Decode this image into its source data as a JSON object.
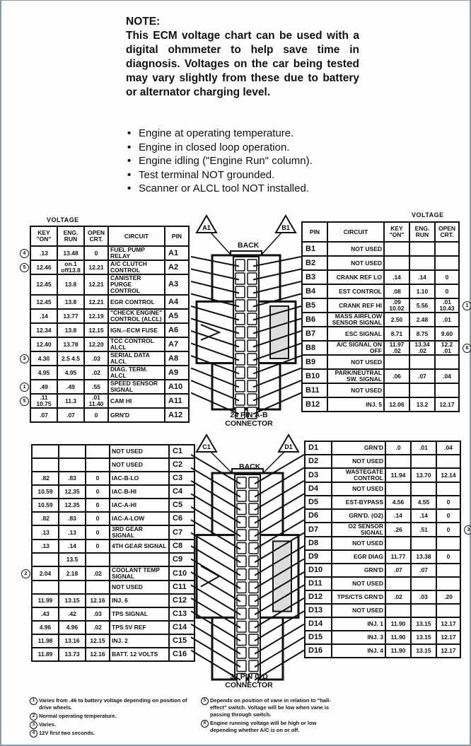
{
  "note": {
    "title": "NOTE:",
    "body": "This ECM voltage chart can be used with a digital ohmmeter to help save time in diagnosis. Voltages on the car being tested may vary slightly from these due to battery or alternator charging level."
  },
  "conditions": [
    "Engine at operating temperature.",
    "Engine in closed loop operation.",
    "Engine idling (\"Engine Run\" column).",
    "Test terminal NOT grounded.",
    "Scanner or ALCL tool NOT installed."
  ],
  "headers": {
    "voltage": "VOLTAGE",
    "key_on": "KEY \"ON\"",
    "eng_run": "ENG. RUN",
    "open_crt": "OPEN CRT.",
    "circuit": "CIRCUIT",
    "pin": "PIN"
  },
  "table_a": [
    {
      "note": "4",
      "key": ".13",
      "run": "13.48",
      "open": "0",
      "circuit": "FUEL PUMP RELAY",
      "pin": "A1"
    },
    {
      "note": "5",
      "key": "12.46",
      "run": "on.1 off13.8",
      "open": "12.21",
      "circuit": "A/C CLUTCH CONTROL",
      "pin": "A2"
    },
    {
      "note": "",
      "key": "12.45",
      "run": "13.8",
      "open": "12.21",
      "circuit": "CANISTER PURGE CONTROL",
      "pin": "A3"
    },
    {
      "note": "",
      "key": "12.45",
      "run": "13.8",
      "open": "12.21",
      "circuit": "EGR CONTROL",
      "pin": "A4"
    },
    {
      "note": "",
      "key": ".14",
      "run": "13.77",
      "open": "12.19",
      "circuit": "\"CHECK ENGINE\" CONTROL (ALCL)",
      "pin": "A5"
    },
    {
      "note": "",
      "key": "12.34",
      "run": "13.8",
      "open": "12.15",
      "circuit": "IGN.--ECM FUSE",
      "pin": "A6"
    },
    {
      "note": "",
      "key": "12.40",
      "run": "13.78",
      "open": "12.20",
      "circuit": "TCC CONTROL ALCL",
      "pin": "A7"
    },
    {
      "note": "3",
      "key": "4.30",
      "run": "2.5 4.5",
      "open": ".03",
      "circuit": "SERIAL DATA ALCL",
      "pin": "A8"
    },
    {
      "note": "",
      "key": "4.95",
      "run": "4.95",
      "open": ".02",
      "circuit": "DIAG. TERM. ALCL",
      "pin": "A9"
    },
    {
      "note": "1",
      "key": ".49",
      "run": ".49",
      "open": ".55",
      "circuit": "SPEED SENSOR SIGNAL",
      "pin": "A10"
    },
    {
      "note": "5",
      "key": ".11 10.75",
      "run": "11.3",
      "open": ".01 11.40",
      "circuit": "CAM HI",
      "pin": "A11"
    },
    {
      "note": "",
      "key": ".07",
      "run": ".07",
      "open": "0",
      "circuit": "GRN'D",
      "pin": "A12"
    }
  ],
  "table_b": [
    {
      "pin": "B1",
      "circuit": "NOT USED",
      "key": "",
      "run": "",
      "open": "",
      "note": ""
    },
    {
      "pin": "B2",
      "circuit": "NOT USED",
      "key": "",
      "run": "",
      "open": "",
      "note": ""
    },
    {
      "pin": "B3",
      "circuit": "CRANK REF LO",
      "key": ".14",
      "run": ".14",
      "open": "0",
      "note": ""
    },
    {
      "pin": "B4",
      "circuit": "EST CONTROL",
      "key": ".08",
      "run": "1.10",
      "open": "0",
      "note": ""
    },
    {
      "pin": "B5",
      "circuit": "CRANK REF HI",
      "key": ".09 10.02",
      "run": "5.56",
      "open": ".01 10.43",
      "note": "1"
    },
    {
      "pin": "B6",
      "circuit": "MASS AIRFLOW SENSOR SIGNAL",
      "key": "2.50",
      "run": "2.48",
      "open": ".01",
      "note": ""
    },
    {
      "pin": "B7",
      "circuit": "ESC SIGNAL",
      "key": "8.71",
      "run": "8.75",
      "open": "9.60",
      "note": ""
    },
    {
      "pin": "B8",
      "circuit": "A/C SIGNAL ON OFF",
      "key": "11.97 .02",
      "run": "13.34 .02",
      "open": "12.2 .01",
      "note": "6"
    },
    {
      "pin": "B9",
      "circuit": "NOT USED",
      "key": "",
      "run": "",
      "open": "",
      "note": ""
    },
    {
      "pin": "B10",
      "circuit": "PARK/NEUTRAL SW. SIGNAL",
      "key": ".06",
      "run": ".07",
      "open": ".04",
      "note": ""
    },
    {
      "pin": "B11",
      "circuit": "NOT USED",
      "key": "",
      "run": "",
      "open": "",
      "note": ""
    },
    {
      "pin": "B12",
      "circuit": "INJ. 5",
      "key": "12.06",
      "run": "13.2",
      "open": "12.17",
      "note": ""
    }
  ],
  "table_c": [
    {
      "note": "",
      "key": "",
      "run": "",
      "open": "",
      "circuit": "NOT USED",
      "pin": "C1"
    },
    {
      "note": "",
      "key": "",
      "run": "",
      "open": "",
      "circuit": "NOT USED",
      "pin": "C2"
    },
    {
      "note": "",
      "key": ".82",
      "run": ".83",
      "open": "0",
      "circuit": "IAC-B-LO",
      "pin": "C3"
    },
    {
      "note": "",
      "key": "10.59",
      "run": "12.35",
      "open": "0",
      "circuit": "IAC-B-HI",
      "pin": "C4"
    },
    {
      "note": "",
      "key": "10.59",
      "run": "12.35",
      "open": "0",
      "circuit": "IAC-A-HI",
      "pin": "C5"
    },
    {
      "note": "",
      "key": ".82",
      "run": ".83",
      "open": "0",
      "circuit": "IAC-A-LOW",
      "pin": "C6"
    },
    {
      "note": "",
      "key": ".13",
      "run": ".13",
      "open": "0",
      "circuit": "3RD GEAR SIGNAL",
      "pin": "C7"
    },
    {
      "note": "",
      "key": ".13",
      "run": ".14",
      "open": "0",
      "circuit": "4TH GEAR SIGNAL",
      "pin": "C8"
    },
    {
      "note": "",
      "key": "",
      "run": "13.5",
      "open": "",
      "circuit": "",
      "pin": "C9"
    },
    {
      "note": "2",
      "key": "2.04",
      "run": "2.18",
      "open": ".02",
      "circuit": "COOLANT TEMP SIGNAL",
      "pin": "C10"
    },
    {
      "note": "",
      "key": "",
      "run": "",
      "open": "",
      "circuit": "NOT USED",
      "pin": "C11"
    },
    {
      "note": "",
      "key": "11.99",
      "run": "13.15",
      "open": "12.16",
      "circuit": "INJ. 6",
      "pin": "C12"
    },
    {
      "note": "",
      "key": ".43",
      "run": ".42",
      "open": ".03",
      "circuit": "TPS SIGNAL",
      "pin": "C13"
    },
    {
      "note": "",
      "key": "4.96",
      "run": "4.96",
      "open": ".02",
      "circuit": "TPS 5V REF",
      "pin": "C14"
    },
    {
      "note": "",
      "key": "11.98",
      "run": "13.16",
      "open": "12.15",
      "circuit": "INJ. 2",
      "pin": "C15"
    },
    {
      "note": "",
      "key": "11.89",
      "run": "13.73",
      "open": "12.16",
      "circuit": "BATT. 12 VOLTS",
      "pin": "C16"
    }
  ],
  "table_d": [
    {
      "pin": "D1",
      "circuit": "GRN'D",
      "key": ".0",
      "run": ".01",
      "open": ".04",
      "note": ""
    },
    {
      "pin": "D2",
      "circuit": "NOT USED",
      "key": "",
      "run": "",
      "open": "",
      "note": ""
    },
    {
      "pin": "D3",
      "circuit": "WASTEGATE CONTROL",
      "key": "11.94",
      "run": "13.70",
      "open": "12.14",
      "note": ""
    },
    {
      "pin": "D4",
      "circuit": "NOT USED",
      "key": "",
      "run": "",
      "open": "",
      "note": ""
    },
    {
      "pin": "D5",
      "circuit": "EST-BYPASS",
      "key": "4.56",
      "run": "4.55",
      "open": "0",
      "note": ""
    },
    {
      "pin": "D6",
      "circuit": "GRN'D. (O2)",
      "key": ".14",
      "run": ".14",
      "open": "0",
      "note": ""
    },
    {
      "pin": "D7",
      "circuit": "O2 SENSOR SIGNAL",
      "key": ".26",
      "run": ".51",
      "open": "0",
      "note": "3"
    },
    {
      "pin": "D8",
      "circuit": "NOT USED",
      "key": "",
      "run": "",
      "open": "",
      "note": ""
    },
    {
      "pin": "D9",
      "circuit": "EGR DIAG",
      "key": "11.77",
      "run": "13.38",
      "open": "0",
      "note": ""
    },
    {
      "pin": "D10",
      "circuit": "GRN'D",
      "key": ".07",
      "run": ".07",
      "open": "",
      "note": ""
    },
    {
      "pin": "D11",
      "circuit": "NOT USED",
      "key": "",
      "run": "",
      "open": "",
      "note": ""
    },
    {
      "pin": "D12",
      "circuit": "TPS/CTS GRN'D",
      "key": ".02",
      "run": ".03",
      "open": ".20",
      "note": ""
    },
    {
      "pin": "D13",
      "circuit": "NOT USED",
      "key": "",
      "run": "",
      "open": "",
      "note": ""
    },
    {
      "pin": "D14",
      "circuit": "INJ. 1",
      "key": "11.90",
      "run": "13.15",
      "open": "12.17",
      "note": ""
    },
    {
      "pin": "D15",
      "circuit": "INJ. 3",
      "key": "11.90",
      "run": "13.15",
      "open": "12.17",
      "note": ""
    },
    {
      "pin": "D16",
      "circuit": "INJ. 4",
      "key": "11.90",
      "run": "13.15",
      "open": "12.17",
      "note": ""
    }
  ],
  "connector_ab": {
    "back": "BACK",
    "left_tag": "A1",
    "right_tag": "B1",
    "label_line1": "24 PIN A-B",
    "label_line2": "CONNECTOR"
  },
  "connector_cd": {
    "back": "BACK",
    "left_tag": "C1",
    "right_tag": "D1",
    "label_line1": "32 PIN C-D",
    "label_line2": "CONNECTOR"
  },
  "footnotes_left": [
    {
      "num": "1",
      "text": "Varies from .46 to battery voltage depending on position of drive wheels."
    },
    {
      "num": "2",
      "text": "Normal operating temperature."
    },
    {
      "num": "3",
      "text": "Varies."
    },
    {
      "num": "4",
      "text": "12V first two seconds."
    }
  ],
  "footnotes_right": [
    {
      "num": "5",
      "text": "Depends on position of vane in relation to \"hall-effect\" switch. Voltage will be low when vane is passing through switch."
    },
    {
      "num": "6",
      "text": "Engine running voltage will be high or low depending whether A/C is on or off."
    }
  ]
}
